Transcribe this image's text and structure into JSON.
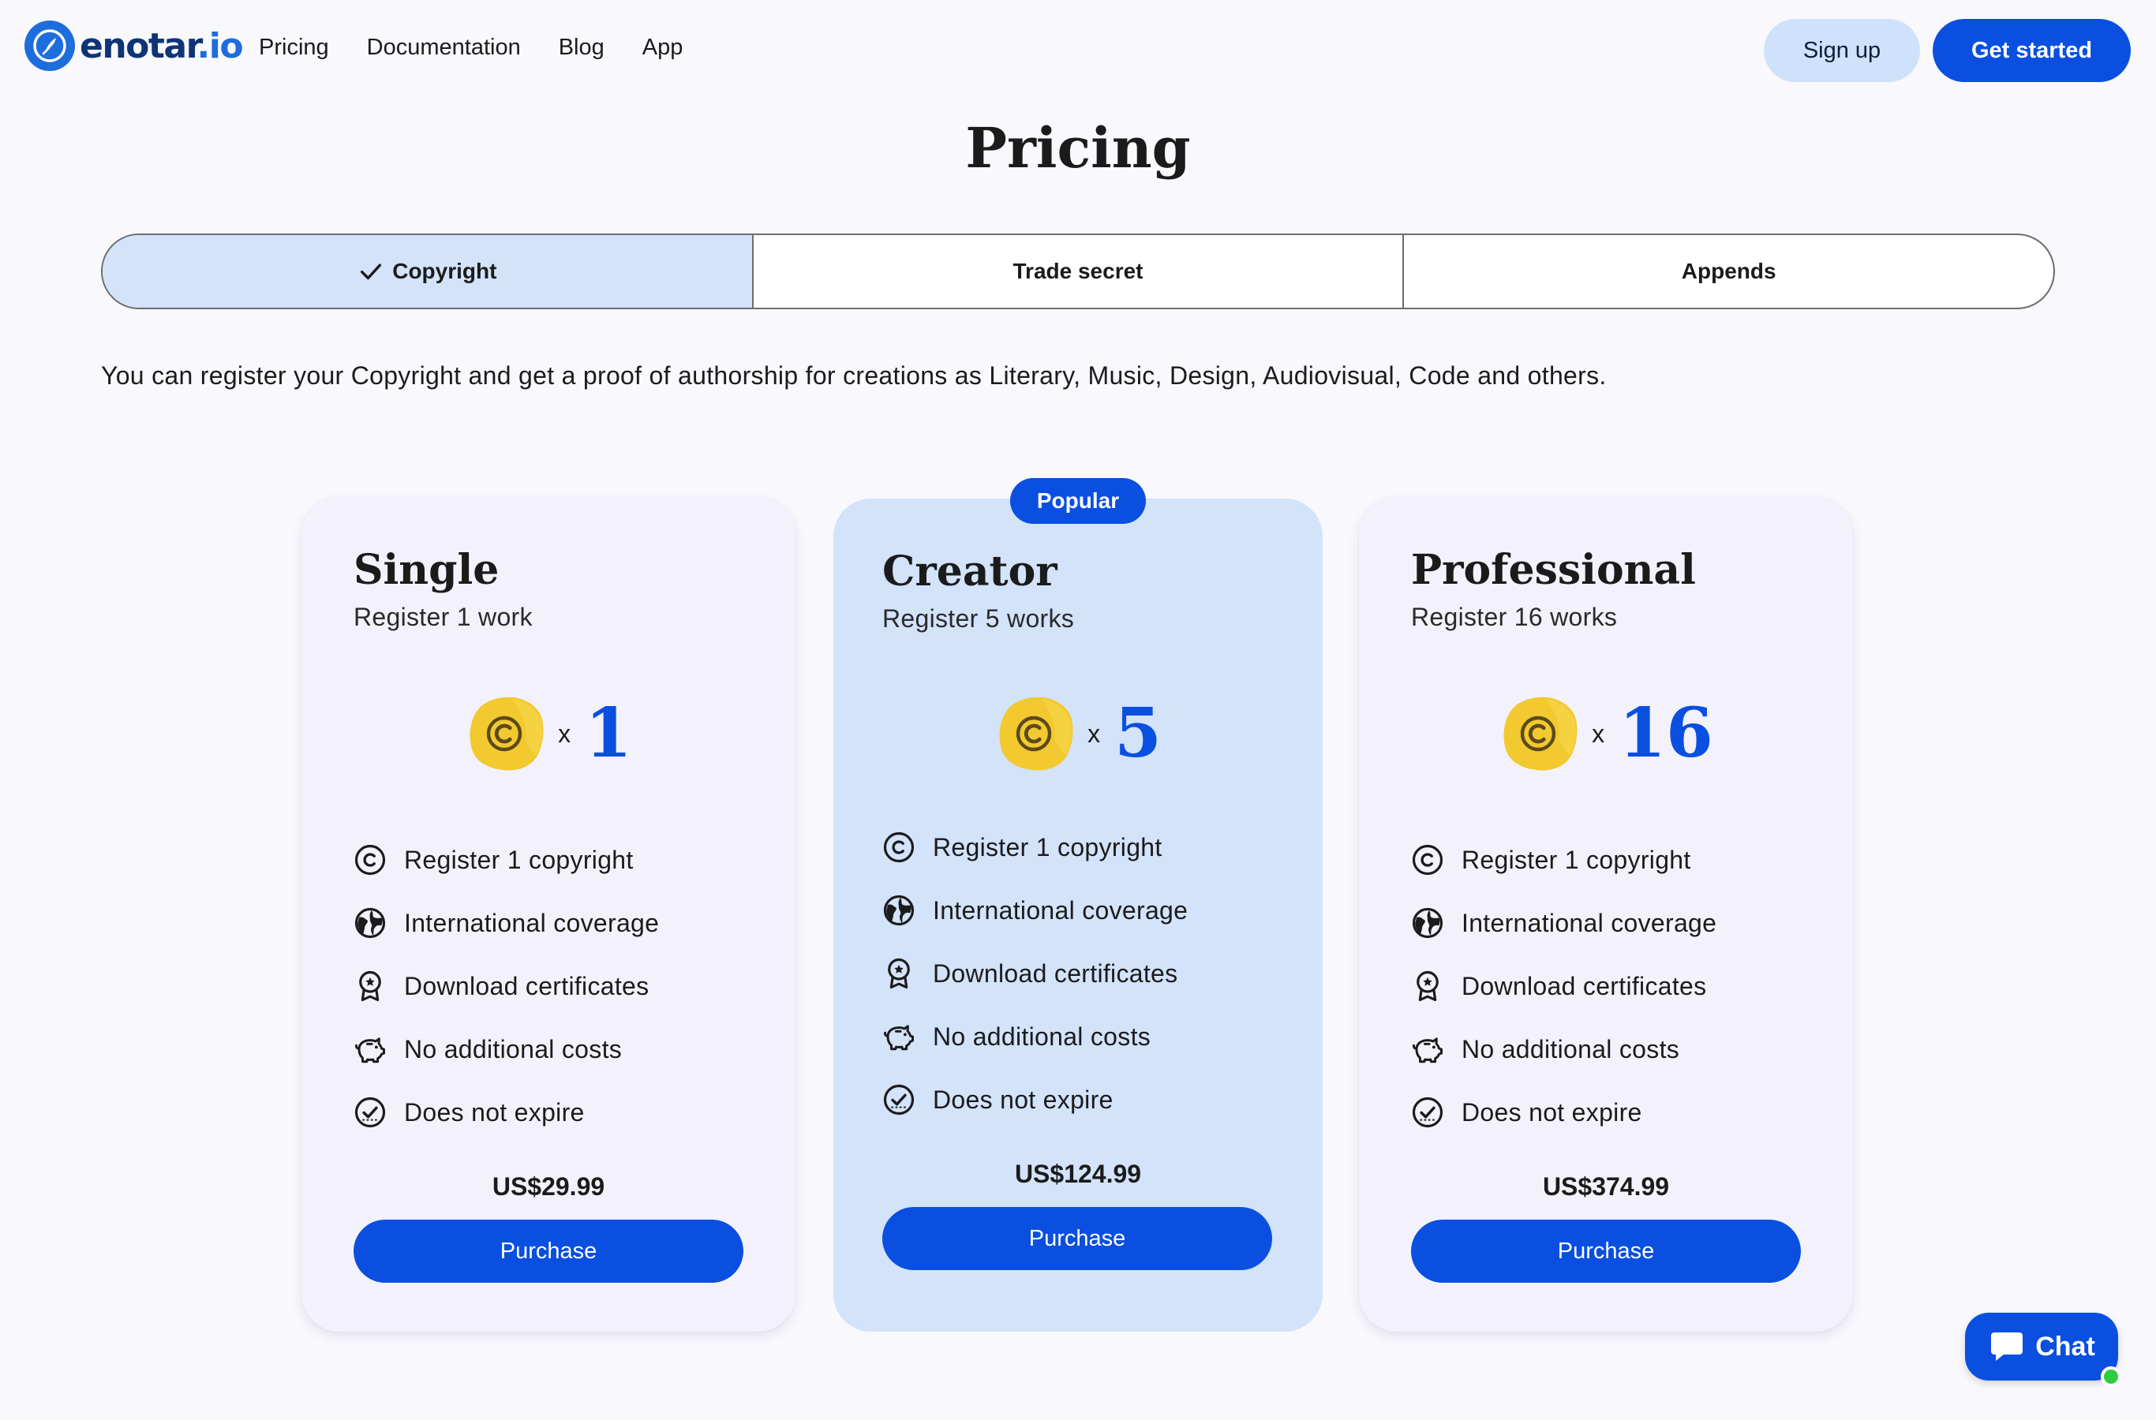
{
  "header": {
    "logo_text_main": "enotar",
    "logo_text_suffix": ".io",
    "nav": [
      "Pricing",
      "Documentation",
      "Blog",
      "App"
    ],
    "signup_label": "Sign up",
    "get_started_label": "Get started"
  },
  "page": {
    "title": "Pricing",
    "description": "You can register your Copyright and get a proof of authorship for creations as Literary, Music, Design, Audiovisual, Code and others."
  },
  "tabs": [
    {
      "label": "Copyright",
      "active": true
    },
    {
      "label": "Trade secret",
      "active": false
    },
    {
      "label": "Appends",
      "active": false
    }
  ],
  "plans": [
    {
      "name": "Single",
      "subtitle": "Register 1 work",
      "times": "x",
      "count": "1",
      "features": [
        "Register 1 copyright",
        "International coverage",
        "Download certificates",
        "No additional costs",
        "Does not expire"
      ],
      "price": "US$29.99",
      "button": "Purchase"
    },
    {
      "name": "Creator",
      "badge": "Popular",
      "subtitle": "Register 5 works",
      "times": "x",
      "count": "5",
      "features": [
        "Register 1 copyright",
        "International coverage",
        "Download certificates",
        "No additional costs",
        "Does not expire"
      ],
      "price": "US$124.99",
      "button": "Purchase"
    },
    {
      "name": "Professional",
      "subtitle": "Register 16 works",
      "times": "x",
      "count": "16",
      "features": [
        "Register 1 copyright",
        "International coverage",
        "Download certificates",
        "No additional costs",
        "Does not expire"
      ],
      "price": "US$374.99",
      "button": "Purchase"
    }
  ],
  "feature_icons": [
    "copyright-icon",
    "globe-icon",
    "award-icon",
    "piggy-bank-icon",
    "check-circle-icon"
  ],
  "chat": {
    "label": "Chat"
  },
  "colors": {
    "accent": "#0a4fe0",
    "accent_light": "#d2e3fa",
    "coin": "#f2c92e",
    "online": "#2ecc40"
  }
}
